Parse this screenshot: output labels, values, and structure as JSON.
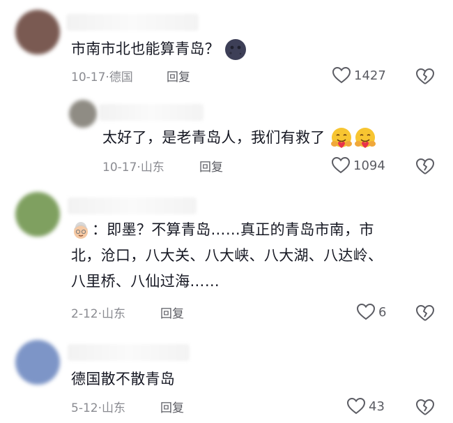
{
  "comments": [
    {
      "text": "市南市北也能算青岛？",
      "date": "10-17",
      "location": "德国",
      "reply_label": "回复",
      "likes": "1427",
      "avatar_color": "#7a5a52",
      "trailing_emoji": "new-moon-face"
    },
    {
      "text": "太好了，是老青岛人，我们有救了",
      "date": "10-17",
      "location": "山东",
      "reply_label": "回复",
      "likes": "1094",
      "avatar_color": "#8f8c84",
      "trailing_emoji": "hugging-face"
    },
    {
      "lines": [
        "：即墨？不算青岛……真正的青岛市南，市",
        "北，沧口，八大关、八大峡、八大湖、八达岭、",
        "八里桥、八仙过海……"
      ],
      "leading_emoji": "old-woman",
      "date": "2-12",
      "location": "山东",
      "reply_label": "回复",
      "likes": "6",
      "avatar_color": "#7fa060"
    },
    {
      "text": "德国散不散青岛",
      "date": "5-12",
      "location": "山东",
      "reply_label": "回复",
      "likes": "43",
      "avatar_color": "#7d95c7"
    }
  ],
  "separator": "·"
}
